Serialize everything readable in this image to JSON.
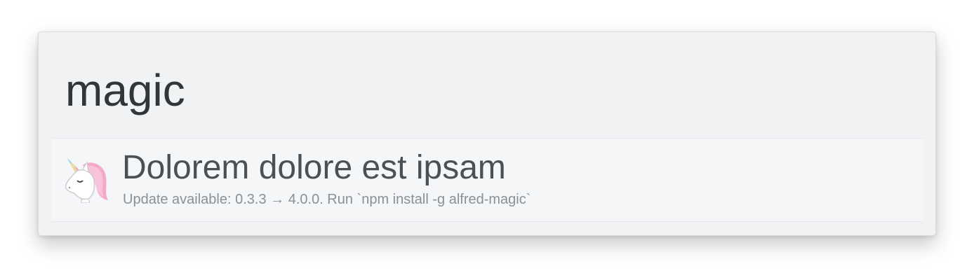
{
  "search": {
    "query": "magic"
  },
  "results": [
    {
      "icon": "unicorn-icon",
      "title": "Dolorem dolore est ipsam",
      "subtitle": "Update available: 0.3.3 → 4.0.0. Run `npm install -g alfred-magic`"
    }
  ],
  "colors": {
    "window_bg": "#f1f2f4",
    "result_bg": "#f5f6f8",
    "query_text": "#32363a",
    "title_text": "#4b5056",
    "subtitle_text": "#8a9097"
  }
}
